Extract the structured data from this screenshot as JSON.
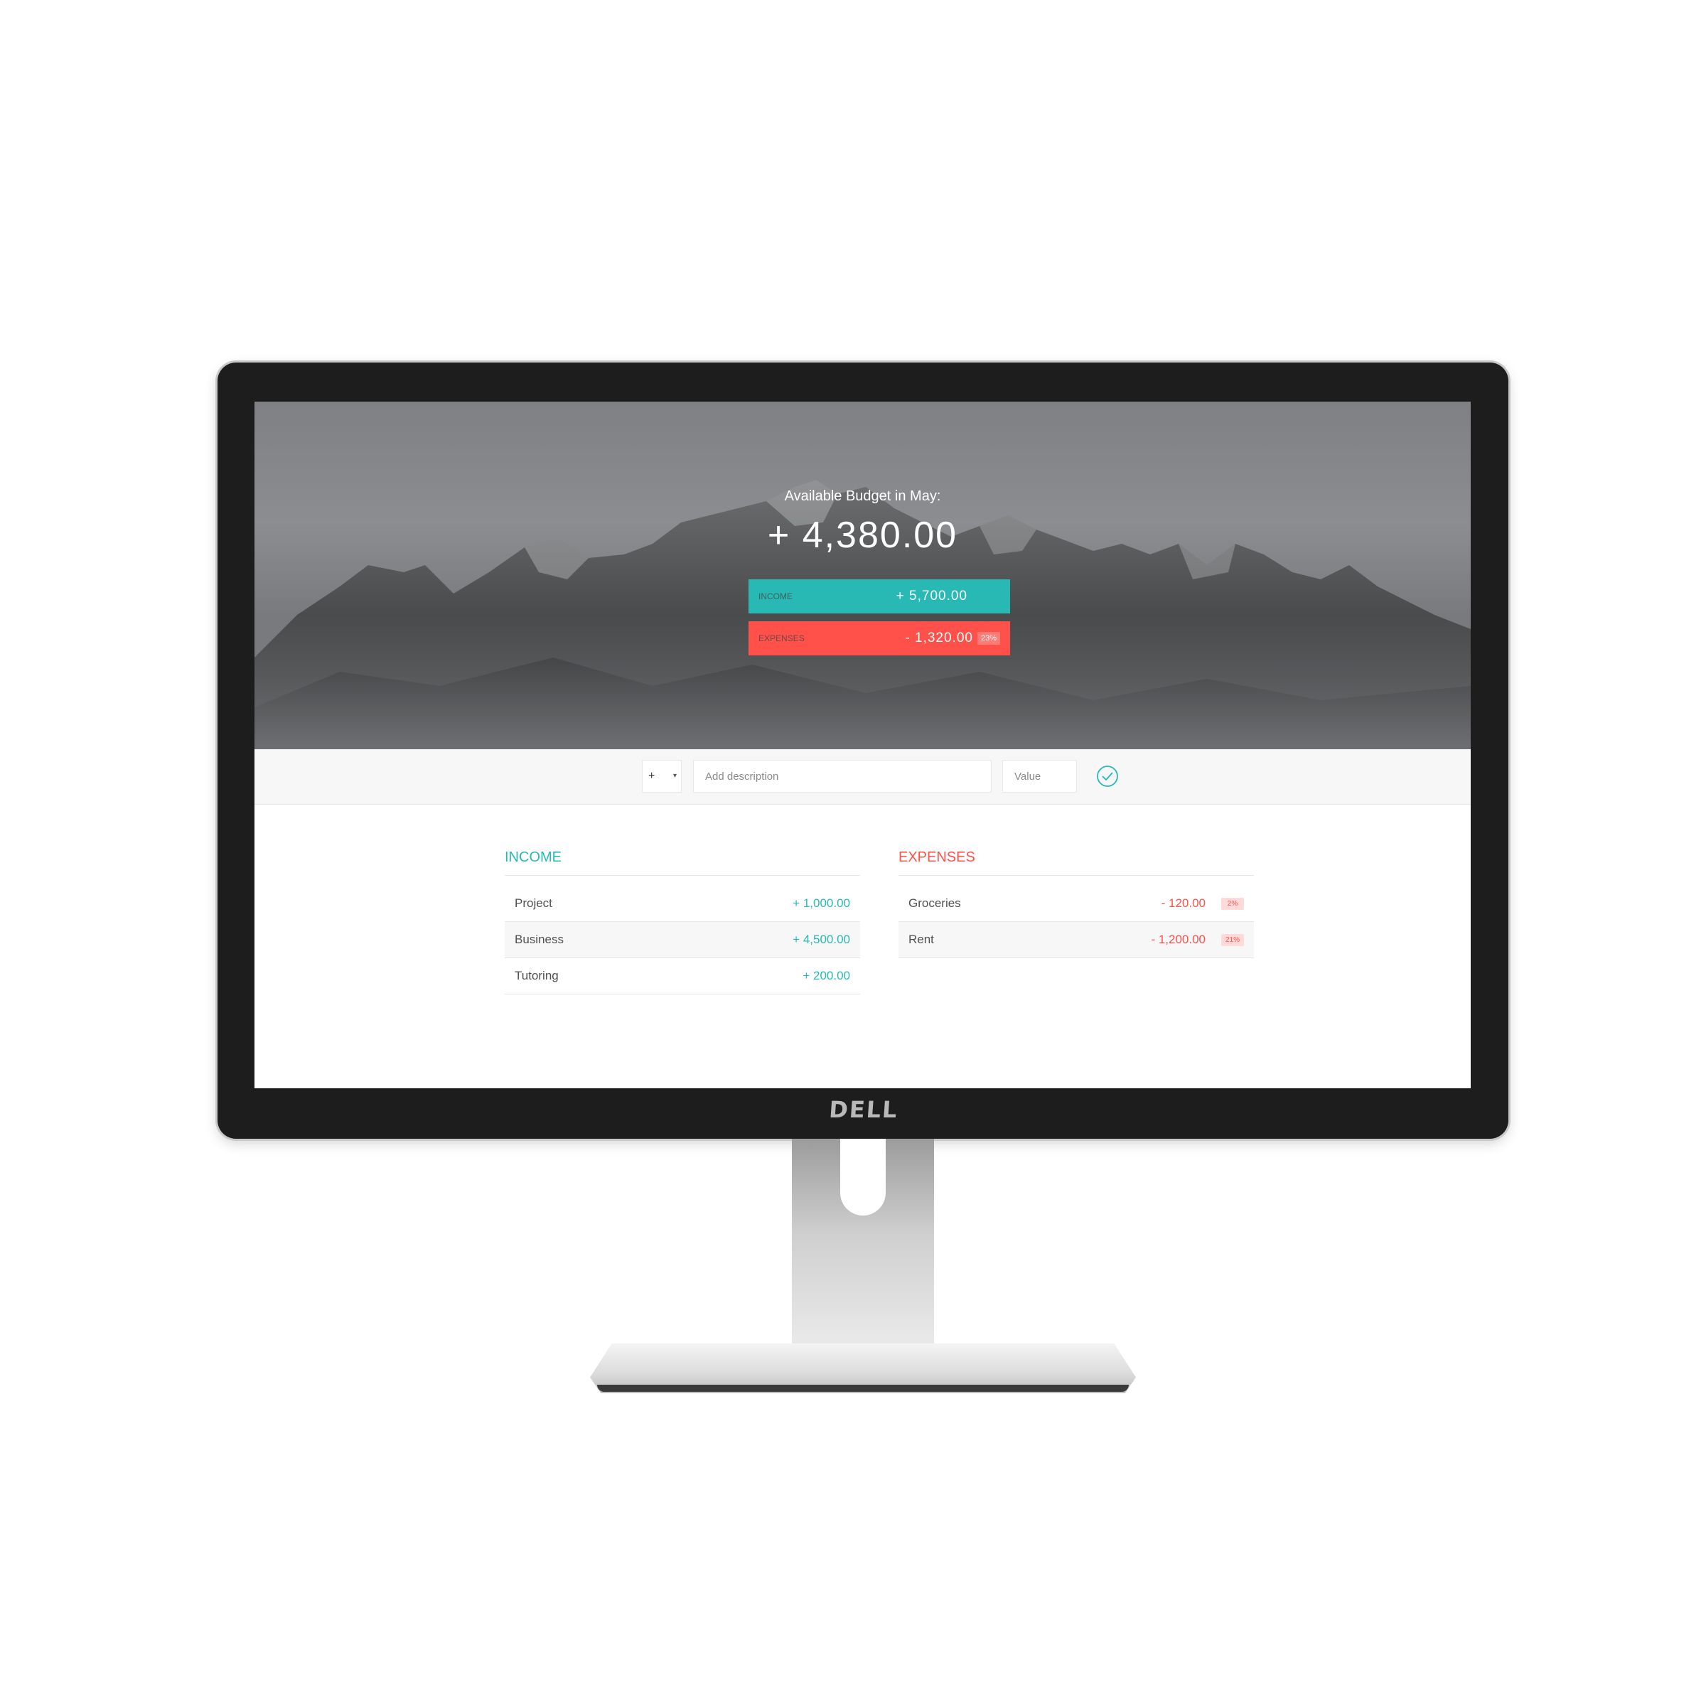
{
  "device": {
    "brand": "DELL"
  },
  "header": {
    "title": "Available Budget in May:",
    "budget": "+ 4,380.00",
    "income_label": "Income",
    "income_value": "+ 5,700.00",
    "expenses_label": "Expenses",
    "expenses_value": "- 1,320.00",
    "expenses_percentage": "23%"
  },
  "add": {
    "type_selected": "+",
    "description_placeholder": "Add description",
    "value_placeholder": "Value",
    "submit_icon": "checkmark-circle-icon"
  },
  "income": {
    "title": "Income",
    "items": [
      {
        "description": "Project",
        "value": "+ 1,000.00"
      },
      {
        "description": "Business",
        "value": "+ 4,500.00"
      },
      {
        "description": "Tutoring",
        "value": "+ 200.00"
      }
    ]
  },
  "expenses": {
    "title": "Expenses",
    "items": [
      {
        "description": "Groceries",
        "value": "- 120.00",
        "percentage": "2%"
      },
      {
        "description": "Rent",
        "value": "- 1,200.00",
        "percentage": "21%"
      }
    ]
  },
  "colors": {
    "income": "#28b9b5",
    "expenses": "#ff5049",
    "bezel": "#1d1d1d"
  }
}
